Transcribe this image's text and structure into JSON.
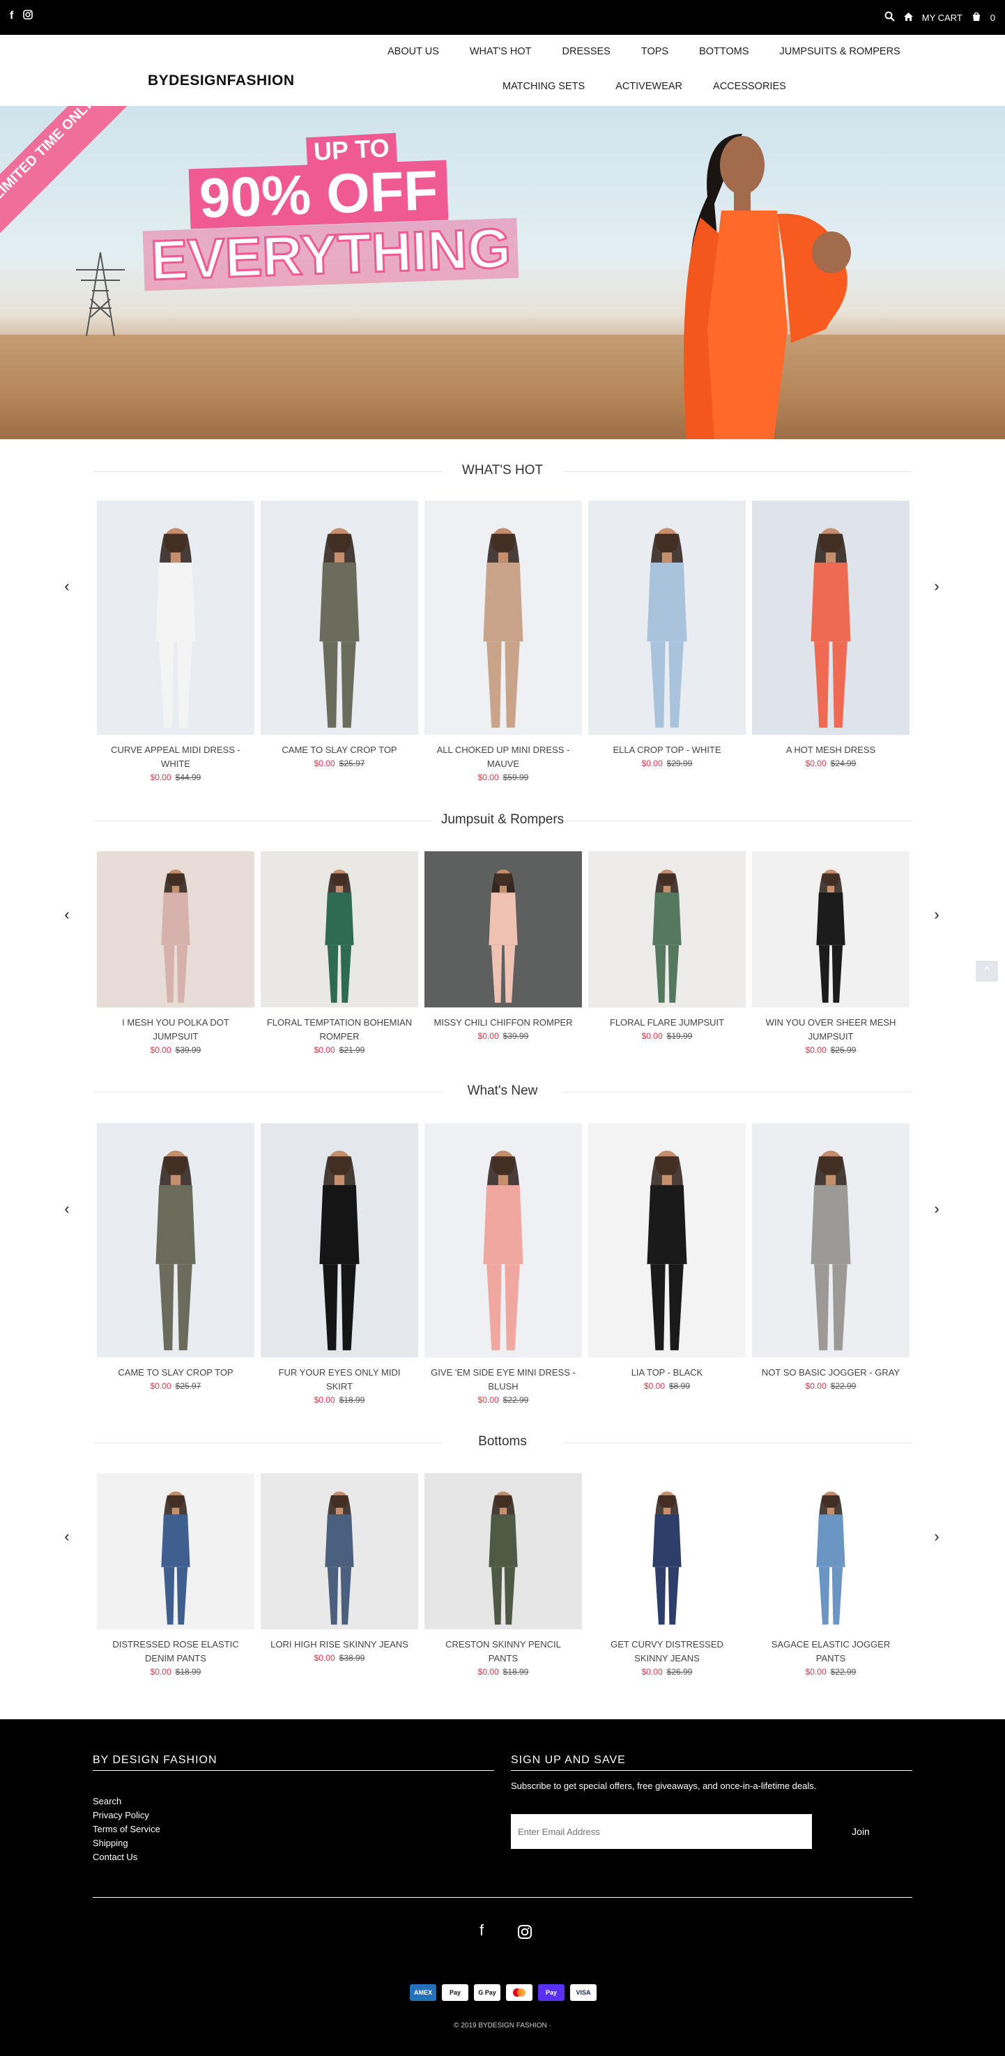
{
  "topbar": {
    "cart_label": "MY CART",
    "cart_count": "0"
  },
  "header": {
    "logo": "BYDESIGNFASHION",
    "nav_row1": [
      "ABOUT US",
      "WHAT'S HOT",
      "DRESSES",
      "TOPS",
      "BOTTOMS",
      "JUMPSUITS & ROMPERS"
    ],
    "nav_row2": [
      "MATCHING SETS",
      "ACTIVEWEAR",
      "ACCESSORIES"
    ]
  },
  "hero": {
    "ribbon": "LIMITED TIME ONLY",
    "up_to": "UP TO",
    "percent": "90% OFF",
    "everything": "EVERYTHING"
  },
  "sections": [
    {
      "title": "WHAT'S HOT",
      "products": [
        {
          "name": "CURVE APPEAL MIDI DRESS - WHITE",
          "price": "$0.00",
          "orig": "$44.99",
          "color": "#f4f4f4",
          "bg": "#e9ecf1"
        },
        {
          "name": "CAME TO SLAY CROP TOP",
          "price": "$0.00",
          "orig": "$25.97",
          "color": "#6b6c5c",
          "bg": "#e9ecf1"
        },
        {
          "name": "ALL CHOKED UP MINI DRESS - MAUVE",
          "price": "$0.00",
          "orig": "$59.99",
          "color": "#c9a48a",
          "bg": "#eef0f3"
        },
        {
          "name": "ELLA CROP TOP - WHITE",
          "price": "$0.00",
          "orig": "$29.99",
          "color": "#a9c3dc",
          "bg": "#e9ecf1"
        },
        {
          "name": "A HOT MESH DRESS",
          "price": "$0.00",
          "orig": "$24.99",
          "color": "#ef6a52",
          "bg": "#dfe3ea"
        }
      ]
    },
    {
      "title": "Jumpsuit & Rompers",
      "products": [
        {
          "name": "I MESH YOU POLKA DOT JUMPSUIT",
          "price": "$0.00",
          "orig": "$39.99",
          "color": "#d7b2ad",
          "bg": "#e7dcd6"
        },
        {
          "name": "FLORAL TEMPTATION BOHEMIAN ROMPER",
          "price": "$0.00",
          "orig": "$21.99",
          "color": "#2f6a55",
          "bg": "#eae8e4"
        },
        {
          "name": "MISSY CHILI CHIFFON ROMPER",
          "price": "$0.00",
          "orig": "$39.99",
          "color": "#f0c2b4",
          "bg": "#5e605f"
        },
        {
          "name": "FLORAL FLARE JUMPSUIT",
          "price": "$0.00",
          "orig": "$19.99",
          "color": "#55785f",
          "bg": "#edecea"
        },
        {
          "name": "WIN YOU OVER SHEER MESH JUMPSUIT",
          "price": "$0.00",
          "orig": "$25.99",
          "color": "#1c1c1c",
          "bg": "#f1f1f1"
        }
      ]
    },
    {
      "title": "What's New",
      "products": [
        {
          "name": "CAME TO SLAY CROP TOP",
          "price": "$0.00",
          "orig": "$25.97",
          "color": "#6b6c5c",
          "bg": "#e9ecf1"
        },
        {
          "name": "FUR YOUR EYES ONLY MIDI SKIRT",
          "price": "$0.00",
          "orig": "$18.99",
          "color": "#151515",
          "bg": "#e4e7ec"
        },
        {
          "name": "GIVE 'EM SIDE EYE MINI DRESS - BLUSH",
          "price": "$0.00",
          "orig": "$22.99",
          "color": "#efa7a0",
          "bg": "#eef0f3"
        },
        {
          "name": "LIA TOP - BLACK",
          "price": "$0.00",
          "orig": "$8.99",
          "color": "#1a1a1a",
          "bg": "#f3f3f3"
        },
        {
          "name": "NOT SO BASIC JOGGER - GRAY",
          "price": "$0.00",
          "orig": "$22.99",
          "color": "#9b9a97",
          "bg": "#eceef1"
        }
      ]
    },
    {
      "title": "Bottoms",
      "products": [
        {
          "name": "DISTRESSED ROSE ELASTIC DENIM PANTS",
          "price": "$0.00",
          "orig": "$18.99",
          "color": "#3f5f8f",
          "bg": "#f2f2f2"
        },
        {
          "name": "LORI HIGH RISE SKINNY JEANS",
          "price": "$0.00",
          "orig": "$38.99",
          "color": "#4b5f7e",
          "bg": "#e9e9e9"
        },
        {
          "name": "CRESTON SKINNY PENCIL PANTS",
          "price": "$0.00",
          "orig": "$18.99",
          "color": "#4e5a44",
          "bg": "#e6e6e6"
        },
        {
          "name": "GET CURVY DISTRESSED SKINNY JEANS",
          "price": "$0.00",
          "orig": "$26.99",
          "color": "#2d3e6b",
          "bg": "#ffffff"
        },
        {
          "name": "SAGACE ELASTIC JOGGER PANTS",
          "price": "$0.00",
          "orig": "$22.99",
          "color": "#6b96c4",
          "bg": "#ffffff"
        }
      ]
    }
  ],
  "footer": {
    "col1_title": "BY DESIGN FASHION",
    "links": [
      "Search",
      "Privacy Policy",
      "Terms of Service",
      "Shipping",
      "Contact Us"
    ],
    "col2_title": "SIGN UP AND SAVE",
    "subscribe_text": "Subscribe to get special offers, free giveaways, and once-in-a-lifetime deals.",
    "email_placeholder": "Enter Email Address",
    "join_label": "Join",
    "payments": [
      "AMEX",
      "Pay",
      "G Pay",
      "MC",
      "Pay",
      "VISA"
    ],
    "copyright": "© 2019 BYDESIGN FASHION ·"
  }
}
